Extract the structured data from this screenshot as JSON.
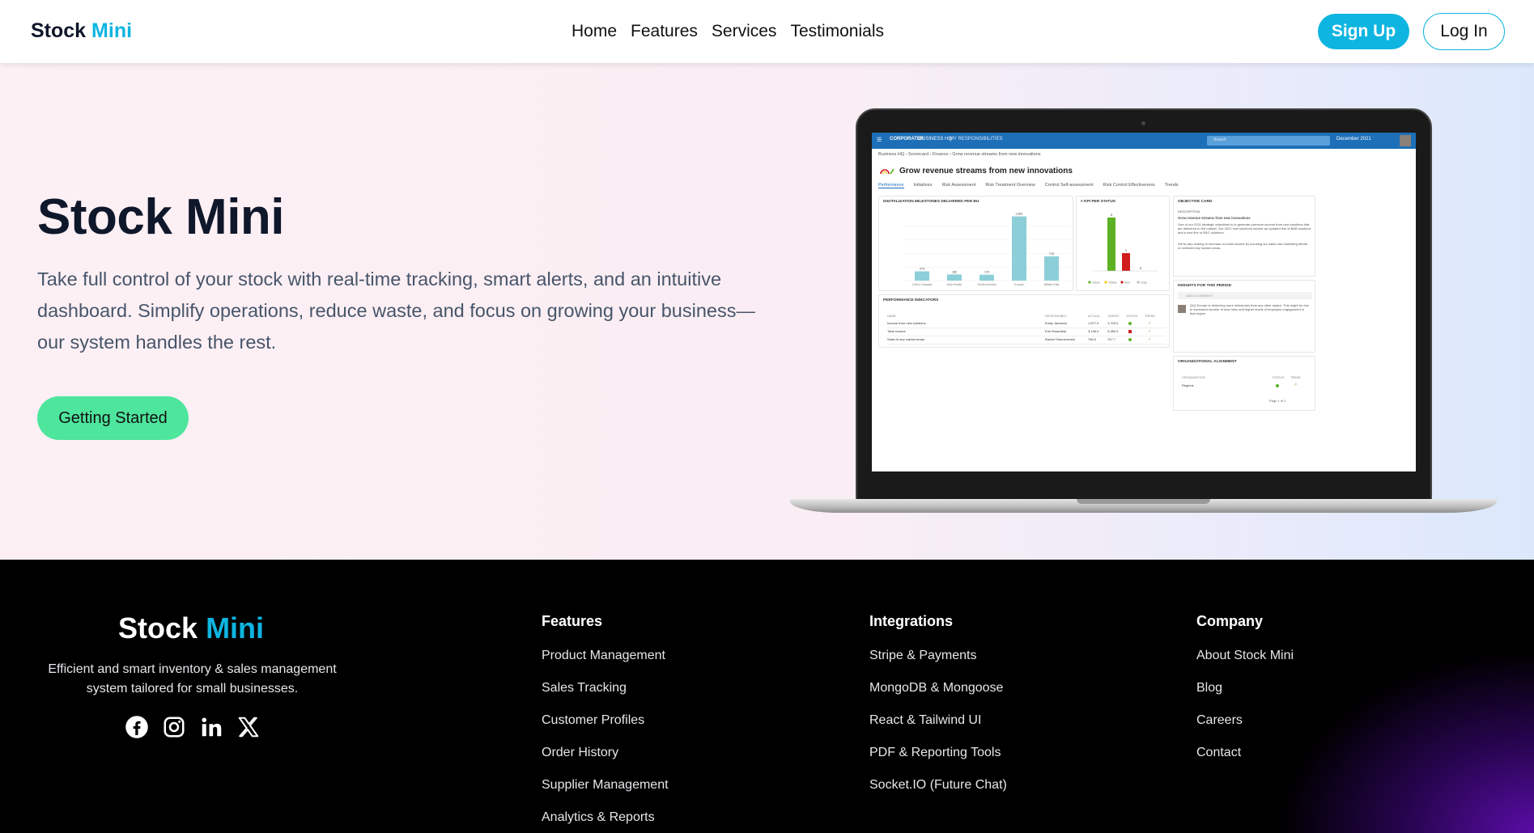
{
  "nav": {
    "brand_main": "Stock",
    "brand_accent": "Mini",
    "links": [
      "Home",
      "Features",
      "Services",
      "Testimonials"
    ],
    "signup_label": "Sign Up",
    "login_label": "Log In"
  },
  "hero": {
    "title": "Stock Mini",
    "description": "Take full control of your stock with real-time tracking, smart alerts, and an intuitive dashboard. Simplify operations, reduce waste, and focus on growing your business—our system handles the rest.",
    "cta_label": "Getting Started"
  },
  "screen": {
    "app_logo": "CORPORATER",
    "app_nav": [
      "BUSINESS HQ",
      "MY RESPONSIBILITIES"
    ],
    "search_placeholder": "Search",
    "date": "December 2021",
    "breadcrumb": "Business HQ  ›  Scorecard  ›  Finance  ›  Grow revenue streams from new innovations",
    "page_title": "Grow revenue streams from new innovations",
    "tabs": [
      "Performance",
      "Initiatives",
      "Risk Assessment",
      "Risk Treatment Overview",
      "Control Self-assessment",
      "Risk Control Effectiveness",
      "Trends"
    ],
    "bar_card_title": "DIGITALIZATION MILESTONES DELIVERED PER BU",
    "bar_values": [
      "274",
      "182",
      "173",
      "1,891",
      "713"
    ],
    "bar_categories": [
      "USA & Canada",
      "Asia Pacific",
      "South America",
      "Europe",
      "Middle East"
    ],
    "kpi_card_title": "# KPI PER STATUS",
    "kpi_values": [
      "3",
      "1",
      "0"
    ],
    "kpi_legend": [
      "Green",
      "Yellow",
      "Red",
      "Gray"
    ],
    "objective_title": "OBJECTIVE CARD",
    "objective_label": "DESCRIPTION",
    "objective_head": "Grow revenue streams from new innovations",
    "objective_text": "One of our 2021 strategic objectives is to generate premium income from new solutions that are delivered to the market. Our 2021 new solutions include an updated line of B&B solutions and a new line of B&C solutions.",
    "objective_text2": "We're also looking to increase our total income by focusing our sales and marketing efforts on selected key market areas.",
    "insights_title": "INSIGHTS FOR THIS PERIOD",
    "comment_placeholder": "ADD A COMMENT",
    "insight_text": "Q/Q Europe is delivering more milestones than any other region. This might be due to increased number of new hires and higher levels of employee engagement in that region.",
    "perf_title": "PERFORMANCE INDICATORS",
    "perf_headers": [
      "NAME",
      "RESPONSIBLE",
      "ACTUAL",
      "TARGET",
      "STATUS",
      "TREND"
    ],
    "perf_rows": [
      {
        "name": "Income from new solutions",
        "resp": "Emily Jameson",
        "actual": "1,877.0",
        "target": "1,720.0"
      },
      {
        "name": "Total Income",
        "resp": "Erik Rosenthal",
        "actual": "3,136.0",
        "target": "3,280.0"
      },
      {
        "name": "Sales in key market areas",
        "resp": "Rachel Zimmermann",
        "actual": "766.0",
        "target": "747.7"
      }
    ],
    "org_title": "ORGANIZATIONAL ALIGNMENT",
    "org_headers": [
      "ORGANIZATION",
      "STATUS",
      "TREND"
    ],
    "org_row": "Regions",
    "pager": "Page 1 of 1"
  },
  "footer": {
    "brand_main": "Stock",
    "brand_accent": "Mini",
    "description": "Efficient and smart inventory & sales management system tailored for small businesses.",
    "columns": [
      {
        "title": "Features",
        "links": [
          "Product Management",
          "Sales Tracking",
          "Customer Profiles",
          "Order History",
          "Supplier Management",
          "Analytics & Reports"
        ]
      },
      {
        "title": "Integrations",
        "links": [
          "Stripe & Payments",
          "MongoDB & Mongoose",
          "React & Tailwind UI",
          "PDF & Reporting Tools",
          "Socket.IO (Future Chat)"
        ]
      },
      {
        "title": "Company",
        "links": [
          "About Stock Mini",
          "Blog",
          "Careers",
          "Contact"
        ]
      }
    ],
    "socials": [
      "facebook-icon",
      "instagram-icon",
      "linkedin-icon",
      "x-icon"
    ]
  },
  "colors": {
    "accent": "#0eb5e0",
    "cta": "#4ee59d",
    "bar": "#8dcfd8",
    "kpi_green": "#5db224",
    "kpi_red": "#d11d1d"
  }
}
